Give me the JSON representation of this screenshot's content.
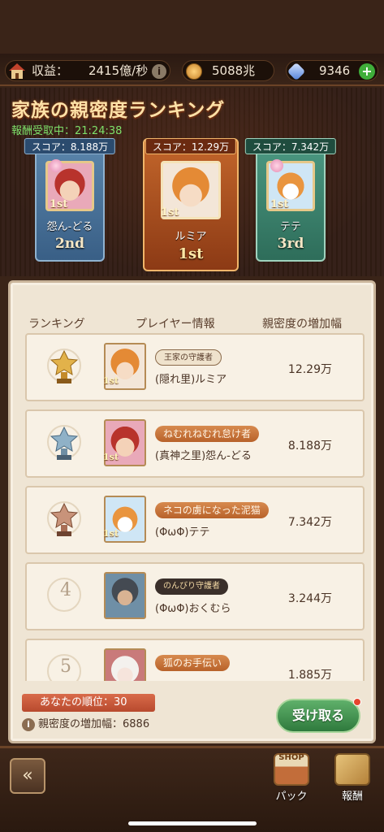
{
  "topbar": {
    "income_label": "収益：",
    "income_value": "2415億/秒",
    "info_icon": "i",
    "coins": "5088兆",
    "gems": "9346",
    "plus": "+"
  },
  "header": {
    "title": "家族の親密度ランキング",
    "timer": "報酬受取中：21:24:38"
  },
  "podium": [
    {
      "place": "2nd",
      "name": "怨ん-どる",
      "score": "スコア：8.188万",
      "badge": "1st"
    },
    {
      "place": "1st",
      "name": "ルミア",
      "score": "スコア：12.29万",
      "badge": "1st"
    },
    {
      "place": "3rd",
      "name": "テテ",
      "score": "スコア：7.342万",
      "badge": "1st"
    }
  ],
  "columns": {
    "rank": "ランキング",
    "player": "プレイヤー情報",
    "increase": "親密度の増加幅"
  },
  "rows": [
    {
      "rank": "1",
      "tag": "王家の守護者",
      "name": "(隠れ里)ルミア",
      "score": "12.29万",
      "badge": "1st"
    },
    {
      "rank": "2",
      "tag": "ねむれねむれ怠け者",
      "name": "(真神之里)怨ん-どる",
      "score": "8.188万",
      "badge": "1st"
    },
    {
      "rank": "3",
      "tag": "ネコの虜になった泥猫",
      "name": "(ΦωΦ)テテ",
      "score": "7.342万",
      "badge": "1st"
    },
    {
      "rank": "4",
      "tag": "のんびり守護者",
      "name": "(ΦωΦ)おくむら",
      "score": "3.244万",
      "badge": ""
    },
    {
      "rank": "5",
      "tag": "狐のお手伝い",
      "name": "",
      "score": "1.885万",
      "badge": ""
    }
  ],
  "footer": {
    "my_rank": "あなたの順位：30",
    "info_icon": "i",
    "my_increase": "親密度の増加幅：6886",
    "receive": "受け取る"
  },
  "bottombar": {
    "back_icon": "«",
    "shop_sign": "SHOP",
    "pack": "パック",
    "reward": "報酬"
  },
  "colors": {
    "accent": "#c3662b",
    "receive": "#3f8f4a",
    "my_rank_bg": "#c85a3a"
  }
}
